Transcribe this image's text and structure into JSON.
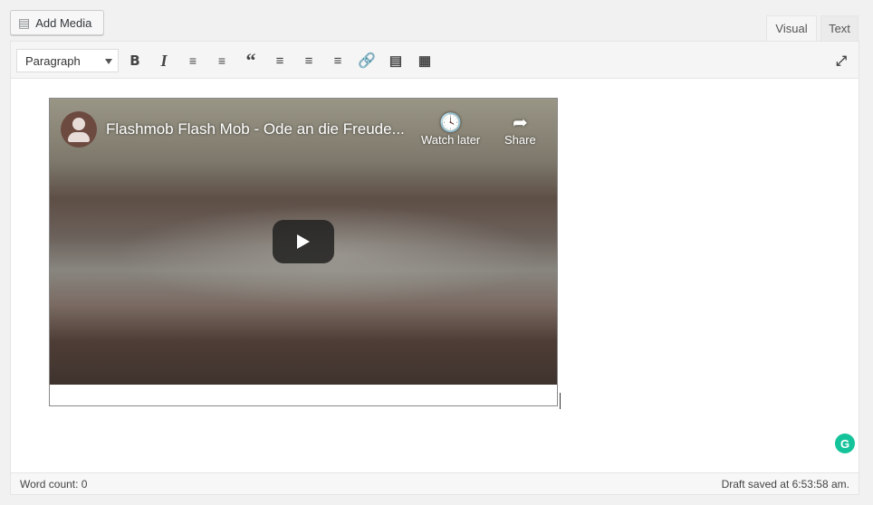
{
  "toolbar_top": {
    "add_media": "Add Media",
    "tabs": [
      {
        "label": "Visual",
        "active": true
      },
      {
        "label": "Text",
        "active": false
      }
    ]
  },
  "editor_toolbar": {
    "format_select": "Paragraph",
    "buttons": [
      "bold",
      "italic",
      "bulleted-list",
      "numbered-list",
      "blockquote",
      "align-left",
      "align-center",
      "align-right",
      "link",
      "read-more",
      "toolbar-toggle"
    ],
    "fullscreen": "fullscreen"
  },
  "video": {
    "title": "Flashmob Flash Mob - Ode an die Freude...",
    "watch_later": "Watch later",
    "share": "Share"
  },
  "status": {
    "word_count": "Word count: 0",
    "draft_saved": "Draft saved at 6:53:58 am."
  },
  "colors": {
    "grammarly": "#15c39a"
  }
}
